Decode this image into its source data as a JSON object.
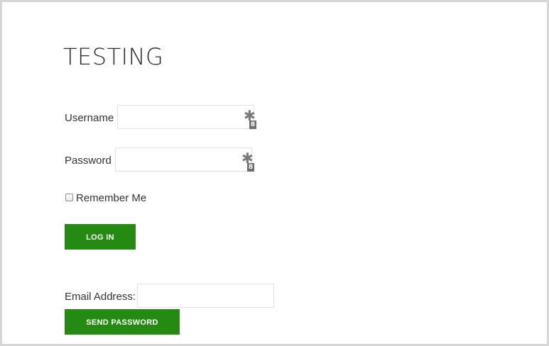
{
  "page": {
    "title": "TESTING"
  },
  "login_form": {
    "username_label": "Username",
    "username_value": "",
    "password_label": "Password",
    "password_value": "",
    "password_badge_symbol": "✱",
    "password_badge_number": "8",
    "remember_label": "Remember Me",
    "remember_checked": false,
    "login_button": "LOG IN"
  },
  "reset_form": {
    "email_label": "Email Address:",
    "email_value": "",
    "send_button": "SEND PASSWORD"
  },
  "colors": {
    "button_bg": "#258a12",
    "frame_border": "#d6d6d6",
    "text": "#333333"
  }
}
